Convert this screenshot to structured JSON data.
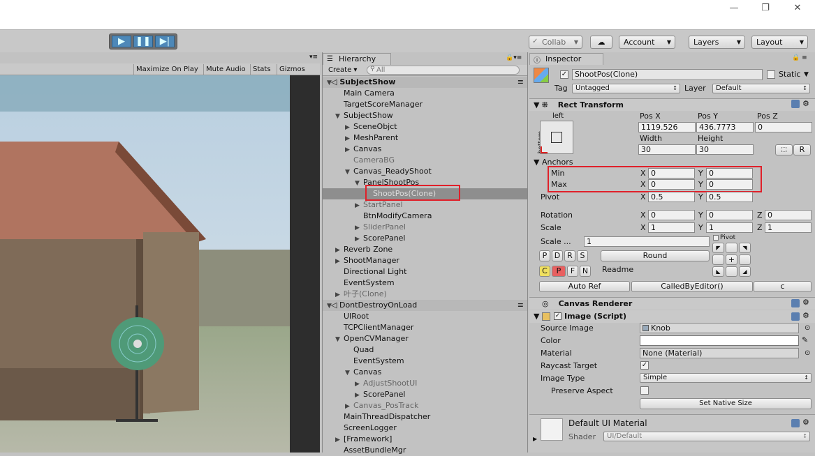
{
  "window": {
    "minimize": "—",
    "restore": "❐",
    "close": "✕"
  },
  "toolbar": {
    "collab": "Collab",
    "account": "Account",
    "layers": "Layers",
    "layout": "Layout"
  },
  "game": {
    "maximize": "Maximize On Play",
    "mute": "Mute Audio",
    "stats": "Stats",
    "gizmos": "Gizmos"
  },
  "hierarchy": {
    "tab": "Hierarchy",
    "create": "Create",
    "search_placeholder": "All",
    "scene": "SubjectShow",
    "dontdestroy": "DontDestroyOnLoad",
    "rows": [
      "Main Camera",
      "TargetScoreManager",
      "SubjectShow",
      "SceneObjct",
      "MeshParent",
      "Canvas",
      "CameraBG",
      "Canvas_ReadyShoot",
      "PanelShootPos",
      "ShootPos(Clone)",
      "StartPanel",
      "BtnModifyCamera",
      "SliderPanel",
      "ScorePanel",
      "Reverb Zone",
      "ShootManager",
      "Directional Light",
      "EventSystem",
      "叶子(Clone)"
    ],
    "rows2": [
      "UIRoot",
      "TCPClientManager",
      "OpenCVManager",
      "Quad",
      "EventSystem",
      "Canvas",
      "AdjustShootUI",
      "ScorePanel",
      "Canvas_PosTrack",
      "MainThreadDispatcher",
      "ScreenLogger",
      "[Framework]",
      "AssetBundleMgr"
    ]
  },
  "inspector": {
    "tab": "Inspector",
    "name": "ShootPos(Clone)",
    "static": "Static",
    "tag_label": "Tag",
    "tag": "Untagged",
    "layer_label": "Layer",
    "layer": "Default",
    "rect": {
      "title": "Rect Transform",
      "left": "left",
      "bottom": "bottom",
      "posx_l": "Pos X",
      "posy_l": "Pos Y",
      "posz_l": "Pos Z",
      "posx": "1119.526",
      "posy": "436.7773",
      "posz": "0",
      "width_l": "Width",
      "height_l": "Height",
      "width": "30",
      "height": "30",
      "r": "R",
      "anchors": "Anchors",
      "min": "Min",
      "max": "Max",
      "x": "X",
      "y": "Y",
      "z": "Z",
      "minx": "0",
      "miny": "0",
      "maxx": "0",
      "maxy": "0",
      "pivot": "Pivot",
      "pivotx": "0.5",
      "pivoty": "0.5",
      "rotation": "Rotation",
      "rotx": "0",
      "roty": "0",
      "rotz": "0",
      "scale": "Scale",
      "scx": "1",
      "scy": "1",
      "scz": "1"
    },
    "tools": {
      "scale_label": "Scale ...",
      "scale_val": "1",
      "pivot_chk": "Pivot",
      "p": "P",
      "d": "D",
      "r": "R",
      "s": "S",
      "round": "Round",
      "c": "C",
      "p2": "P",
      "f": "F",
      "n": "N",
      "readme": "Readme",
      "plus": "+",
      "autoref": "Auto Ref",
      "called": "CalledByEditor()",
      "c2": "c"
    },
    "canvas_renderer": "Canvas Renderer",
    "image": {
      "title": "Image (Script)",
      "source_l": "Source Image",
      "source": "Knob",
      "color_l": "Color",
      "material_l": "Material",
      "material": "None (Material)",
      "raycast_l": "Raycast Target",
      "type_l": "Image Type",
      "type": "Simple",
      "preserve_l": "Preserve Aspect",
      "native": "Set Native Size"
    },
    "material": {
      "title": "Default UI Material",
      "shader_l": "Shader",
      "shader": "UI/Default"
    }
  }
}
